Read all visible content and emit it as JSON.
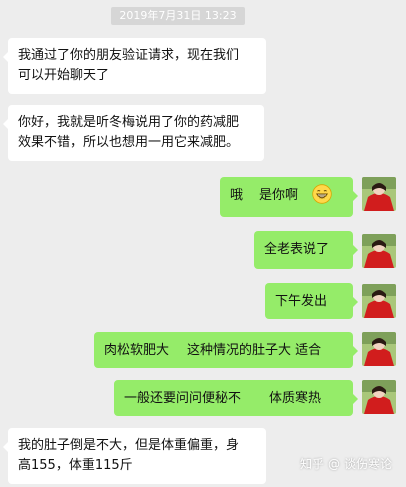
{
  "timestamp": "2019年7月31日 13:23",
  "messages": [
    {
      "side": "left",
      "lines": [
        "我通过了你的朋友验证请求，现在我们",
        "可以开始聊天了"
      ]
    },
    {
      "side": "left",
      "lines": [
        "你好，我就是听冬梅说用了你的药减肥",
        "效果不错，所以也想用一用它来减肥。"
      ]
    },
    {
      "side": "right",
      "parts": [
        "哦",
        "是你啊"
      ],
      "emoji": "grinning-face-emoji"
    },
    {
      "side": "right",
      "lines": [
        "全老表说了"
      ]
    },
    {
      "side": "right",
      "lines": [
        "下午发出"
      ]
    },
    {
      "side": "right",
      "parts": [
        "肉松软肥大",
        "这种情况的肚子大 适合"
      ]
    },
    {
      "side": "right",
      "parts": [
        "一般还要问问便秘不",
        "体质寒热"
      ]
    },
    {
      "side": "left",
      "lines": [
        "我的肚子倒是不大，但是体重偏重，身",
        "高155，体重115斤"
      ]
    }
  ],
  "watermark": {
    "site": "知乎",
    "at": "@",
    "user": "谈伤寒论"
  },
  "colors": {
    "background": "#ededed",
    "left_bubble": "#ffffff",
    "right_bubble": "#95ec69",
    "timestamp_bg": "#d6d6d6"
  }
}
